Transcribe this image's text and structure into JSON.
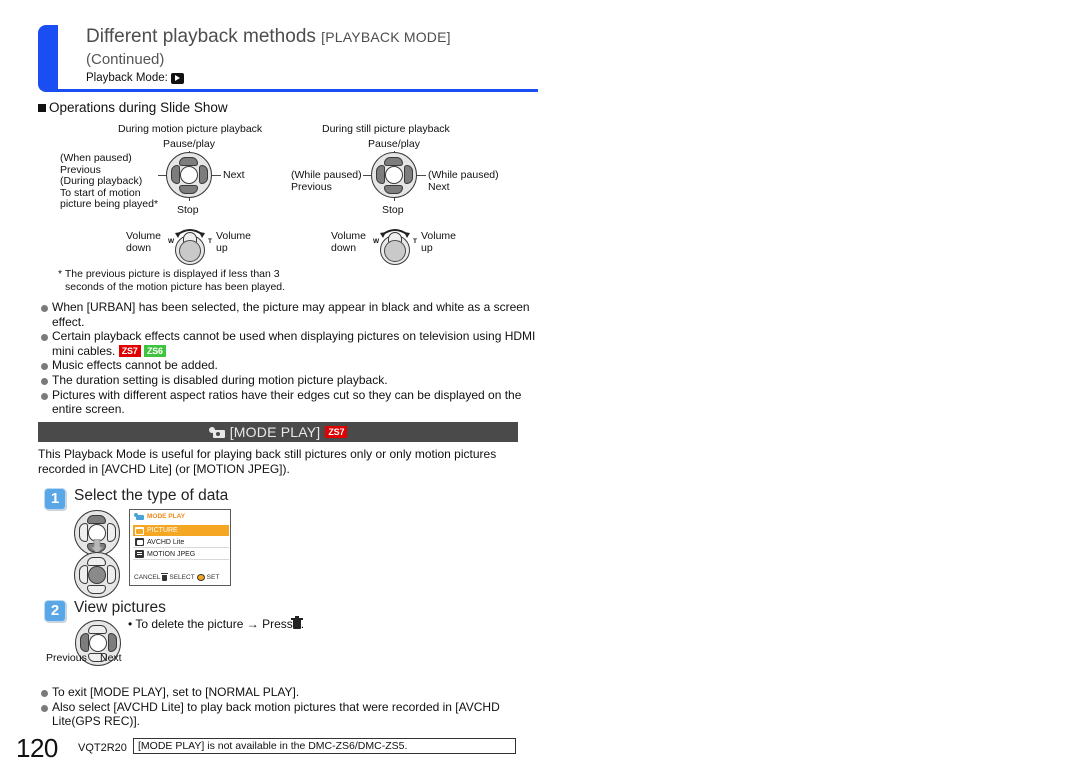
{
  "header": {
    "title_main": "Different playback methods",
    "title_bracket": "[PLAYBACK MODE]",
    "continued": "(Continued)",
    "mode_label": "Playback Mode:",
    "mode_icon": "playback-mode-icon"
  },
  "section": {
    "heading": "Operations during Slide Show"
  },
  "diagrams": [
    {
      "caption": "During motion picture playback",
      "pad_top_label": "Pause/play",
      "pad_right_label": "Next",
      "pad_bottom_label": "Stop",
      "pad_left_lines": [
        "(When paused)",
        "Previous",
        "(During playback)",
        "To start of motion",
        "picture being played*"
      ],
      "lever_left_lines": [
        "Volume",
        "down"
      ],
      "lever_right_lines": [
        "Volume",
        "up"
      ],
      "lever_w": "W",
      "lever_t": "T"
    },
    {
      "caption": "During still picture playback",
      "pad_top_label": "Pause/play",
      "pad_bottom_label": "Stop",
      "pad_left_lines": [
        "(While paused)",
        "Previous"
      ],
      "pad_right_lines": [
        "(While paused)",
        "Next"
      ],
      "lever_left_lines": [
        "Volume",
        "down"
      ],
      "lever_right_lines": [
        "Volume",
        "up"
      ],
      "lever_w": "W",
      "lever_t": "T"
    }
  ],
  "footnote": {
    "line1": "* The previous picture is displayed if less than 3",
    "line2": "seconds of the motion picture has been played."
  },
  "bullets": [
    {
      "text": "When [URBAN] has been selected, the picture may appear in black and white as a screen effect.",
      "badges": []
    },
    {
      "text": "Certain playback effects cannot be used when displaying pictures on television using HDMI mini cables.",
      "badges": [
        "ZS7",
        "ZS6"
      ]
    },
    {
      "text": "Music effects cannot be added.",
      "badges": []
    },
    {
      "text": "The duration setting is disabled during motion picture playback.",
      "badges": []
    },
    {
      "text": "Pictures with different aspect ratios have their edges cut so they can be displayed on the entire screen.",
      "badges": []
    }
  ],
  "mode_section": {
    "bar_title": "[MODE PLAY]",
    "bar_badge": "ZS7",
    "bar_icon": "camera-icon",
    "description": "This Playback Mode is useful for playing back still pictures only or only motion pictures recorded in [AVCHD Lite] (or [MOTION JPEG])."
  },
  "steps": [
    {
      "number": "1",
      "title": "Select the type of data"
    },
    {
      "number": "2",
      "title": "View pictures",
      "note": "To delete the picture → Press",
      "note_icon": "trash-icon",
      "pad_left_label": "Previous",
      "pad_right_label": "Next"
    }
  ],
  "lcd": {
    "title": "MODE PLAY",
    "title_icon": "camera-icon",
    "items": [
      {
        "label": "PICTURE",
        "icon": "picture-icon",
        "selected": true
      },
      {
        "label": "AVCHD Lite",
        "icon": "avchd-icon",
        "selected": false
      },
      {
        "label": "MOTION JPEG",
        "icon": "mjpeg-icon",
        "selected": false
      }
    ],
    "footer_cancel": "CANCEL",
    "footer_select": "SELECT",
    "footer_set": "SET"
  },
  "bottom_bullets": [
    "To exit [MODE PLAY], set to [NORMAL PLAY].",
    "Also select [AVCHD Lite] to play back motion pictures that were recorded in [AVCHD Lite(GPS REC)]."
  ],
  "footer": {
    "page_number": "120",
    "doc_code": "VQT2R20",
    "note": "[MODE PLAY] is not available in the DMC-ZS6/DMC-ZS5."
  },
  "colors": {
    "accent_blue": "#1b4ef2",
    "badge_red": "#e00000",
    "badge_green": "#3ec43e",
    "bar_gray": "#4a4a4a",
    "lcd_orange": "#f5a623",
    "step_blue": "#5aa7e8"
  }
}
